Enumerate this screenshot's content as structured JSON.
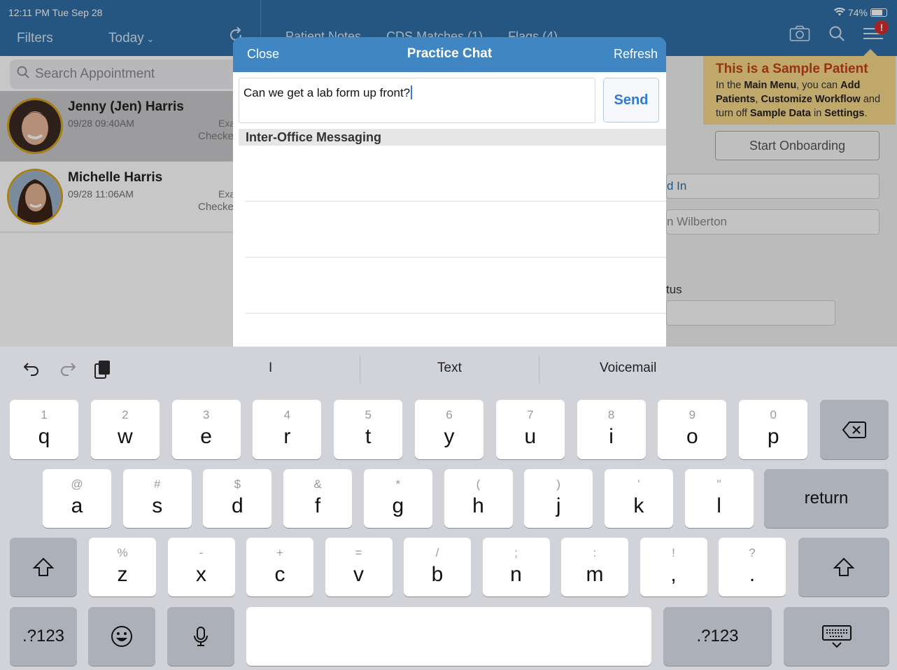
{
  "status_bar": {
    "time": "12:11 PM  Tue Sep 28",
    "battery": "74%"
  },
  "nav": {
    "filters": "Filters",
    "today": "Today",
    "tabs": [
      "Patient Notes",
      "CDS Matches (1)",
      "Flags (4)"
    ],
    "alert_badge": "!"
  },
  "search": {
    "placeholder": "Search Appointment"
  },
  "appointments": [
    {
      "name": "Jenny (Jen) Harris",
      "time": "09/28 09:40AM",
      "type": "Exa",
      "status": "Checke"
    },
    {
      "name": "Michelle Harris",
      "time": "09/28 11:06AM",
      "type": "Exa",
      "status": "Checke"
    }
  ],
  "sample_callout": {
    "title": "This is a Sample Patient",
    "line1_pre": "In the ",
    "line1_bold1": "Main Menu",
    "line1_mid": ", you can ",
    "line1_bold2": "Add",
    "line2_bold1": "Patients",
    "line2_mid": ", ",
    "line2_bold2": "Customize Workflow",
    "line2_post": " and",
    "line3_pre": "turn off ",
    "line3_bold1": "Sample Data",
    "line3_mid": " in ",
    "line3_bold2": "Settings",
    "line3_post": "."
  },
  "right_pane": {
    "onboard_button": "Start Onboarding",
    "checked_in_partial": "d In",
    "provider_partial": "n Wilberton",
    "status_label_partial": "tus"
  },
  "modal": {
    "close": "Close",
    "title": "Practice Chat",
    "refresh": "Refresh",
    "input_value": "Can we get a lab form up front?",
    "send": "Send",
    "section_header": "Inter-Office Messaging"
  },
  "keyboard": {
    "suggestions": [
      "I",
      "Text",
      "Voicemail"
    ],
    "row1": [
      {
        "alt": "1",
        "main": "q"
      },
      {
        "alt": "2",
        "main": "w"
      },
      {
        "alt": "3",
        "main": "e"
      },
      {
        "alt": "4",
        "main": "r"
      },
      {
        "alt": "5",
        "main": "t"
      },
      {
        "alt": "6",
        "main": "y"
      },
      {
        "alt": "7",
        "main": "u"
      },
      {
        "alt": "8",
        "main": "i"
      },
      {
        "alt": "9",
        "main": "o"
      },
      {
        "alt": "0",
        "main": "p"
      }
    ],
    "row2": [
      {
        "alt": "@",
        "main": "a"
      },
      {
        "alt": "#",
        "main": "s"
      },
      {
        "alt": "$",
        "main": "d"
      },
      {
        "alt": "&",
        "main": "f"
      },
      {
        "alt": "*",
        "main": "g"
      },
      {
        "alt": "(",
        "main": "h"
      },
      {
        "alt": ")",
        "main": "j"
      },
      {
        "alt": "'",
        "main": "k"
      },
      {
        "alt": "\"",
        "main": "l"
      }
    ],
    "row3": [
      {
        "alt": "%",
        "main": "z"
      },
      {
        "alt": "-",
        "main": "x"
      },
      {
        "alt": "+",
        "main": "c"
      },
      {
        "alt": "=",
        "main": "v"
      },
      {
        "alt": "/",
        "main": "b"
      },
      {
        "alt": ";",
        "main": "n"
      },
      {
        "alt": ":",
        "main": "m"
      },
      {
        "alt": "!",
        "main": ","
      },
      {
        "alt": "?",
        "main": "."
      }
    ],
    "return": "return",
    "numbers_left": ".?123",
    "numbers_right": ".?123"
  }
}
